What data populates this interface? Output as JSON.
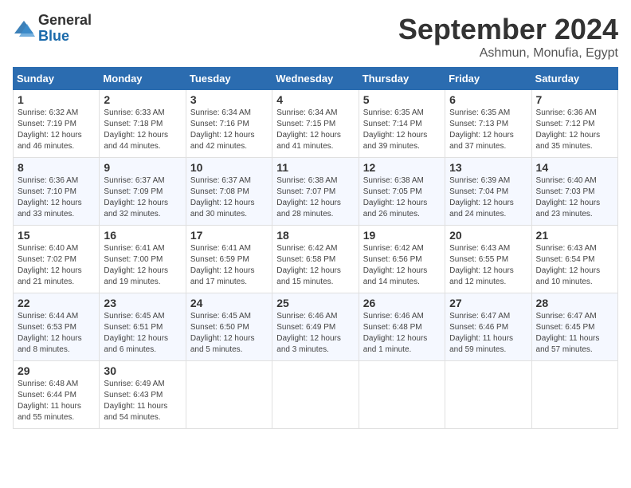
{
  "header": {
    "logo": {
      "general": "General",
      "blue": "Blue"
    },
    "title": "September 2024",
    "location": "Ashmun, Monufia, Egypt"
  },
  "days_of_week": [
    "Sunday",
    "Monday",
    "Tuesday",
    "Wednesday",
    "Thursday",
    "Friday",
    "Saturday"
  ],
  "weeks": [
    [
      {
        "day": "1",
        "info": "Sunrise: 6:32 AM\nSunset: 7:19 PM\nDaylight: 12 hours and 46 minutes."
      },
      {
        "day": "2",
        "info": "Sunrise: 6:33 AM\nSunset: 7:18 PM\nDaylight: 12 hours and 44 minutes."
      },
      {
        "day": "3",
        "info": "Sunrise: 6:34 AM\nSunset: 7:16 PM\nDaylight: 12 hours and 42 minutes."
      },
      {
        "day": "4",
        "info": "Sunrise: 6:34 AM\nSunset: 7:15 PM\nDaylight: 12 hours and 41 minutes."
      },
      {
        "day": "5",
        "info": "Sunrise: 6:35 AM\nSunset: 7:14 PM\nDaylight: 12 hours and 39 minutes."
      },
      {
        "day": "6",
        "info": "Sunrise: 6:35 AM\nSunset: 7:13 PM\nDaylight: 12 hours and 37 minutes."
      },
      {
        "day": "7",
        "info": "Sunrise: 6:36 AM\nSunset: 7:12 PM\nDaylight: 12 hours and 35 minutes."
      }
    ],
    [
      {
        "day": "8",
        "info": "Sunrise: 6:36 AM\nSunset: 7:10 PM\nDaylight: 12 hours and 33 minutes."
      },
      {
        "day": "9",
        "info": "Sunrise: 6:37 AM\nSunset: 7:09 PM\nDaylight: 12 hours and 32 minutes."
      },
      {
        "day": "10",
        "info": "Sunrise: 6:37 AM\nSunset: 7:08 PM\nDaylight: 12 hours and 30 minutes."
      },
      {
        "day": "11",
        "info": "Sunrise: 6:38 AM\nSunset: 7:07 PM\nDaylight: 12 hours and 28 minutes."
      },
      {
        "day": "12",
        "info": "Sunrise: 6:38 AM\nSunset: 7:05 PM\nDaylight: 12 hours and 26 minutes."
      },
      {
        "day": "13",
        "info": "Sunrise: 6:39 AM\nSunset: 7:04 PM\nDaylight: 12 hours and 24 minutes."
      },
      {
        "day": "14",
        "info": "Sunrise: 6:40 AM\nSunset: 7:03 PM\nDaylight: 12 hours and 23 minutes."
      }
    ],
    [
      {
        "day": "15",
        "info": "Sunrise: 6:40 AM\nSunset: 7:02 PM\nDaylight: 12 hours and 21 minutes."
      },
      {
        "day": "16",
        "info": "Sunrise: 6:41 AM\nSunset: 7:00 PM\nDaylight: 12 hours and 19 minutes."
      },
      {
        "day": "17",
        "info": "Sunrise: 6:41 AM\nSunset: 6:59 PM\nDaylight: 12 hours and 17 minutes."
      },
      {
        "day": "18",
        "info": "Sunrise: 6:42 AM\nSunset: 6:58 PM\nDaylight: 12 hours and 15 minutes."
      },
      {
        "day": "19",
        "info": "Sunrise: 6:42 AM\nSunset: 6:56 PM\nDaylight: 12 hours and 14 minutes."
      },
      {
        "day": "20",
        "info": "Sunrise: 6:43 AM\nSunset: 6:55 PM\nDaylight: 12 hours and 12 minutes."
      },
      {
        "day": "21",
        "info": "Sunrise: 6:43 AM\nSunset: 6:54 PM\nDaylight: 12 hours and 10 minutes."
      }
    ],
    [
      {
        "day": "22",
        "info": "Sunrise: 6:44 AM\nSunset: 6:53 PM\nDaylight: 12 hours and 8 minutes."
      },
      {
        "day": "23",
        "info": "Sunrise: 6:45 AM\nSunset: 6:51 PM\nDaylight: 12 hours and 6 minutes."
      },
      {
        "day": "24",
        "info": "Sunrise: 6:45 AM\nSunset: 6:50 PM\nDaylight: 12 hours and 5 minutes."
      },
      {
        "day": "25",
        "info": "Sunrise: 6:46 AM\nSunset: 6:49 PM\nDaylight: 12 hours and 3 minutes."
      },
      {
        "day": "26",
        "info": "Sunrise: 6:46 AM\nSunset: 6:48 PM\nDaylight: 12 hours and 1 minute."
      },
      {
        "day": "27",
        "info": "Sunrise: 6:47 AM\nSunset: 6:46 PM\nDaylight: 11 hours and 59 minutes."
      },
      {
        "day": "28",
        "info": "Sunrise: 6:47 AM\nSunset: 6:45 PM\nDaylight: 11 hours and 57 minutes."
      }
    ],
    [
      {
        "day": "29",
        "info": "Sunrise: 6:48 AM\nSunset: 6:44 PM\nDaylight: 11 hours and 55 minutes."
      },
      {
        "day": "30",
        "info": "Sunrise: 6:49 AM\nSunset: 6:43 PM\nDaylight: 11 hours and 54 minutes."
      },
      {
        "day": "",
        "info": ""
      },
      {
        "day": "",
        "info": ""
      },
      {
        "day": "",
        "info": ""
      },
      {
        "day": "",
        "info": ""
      },
      {
        "day": "",
        "info": ""
      }
    ]
  ]
}
